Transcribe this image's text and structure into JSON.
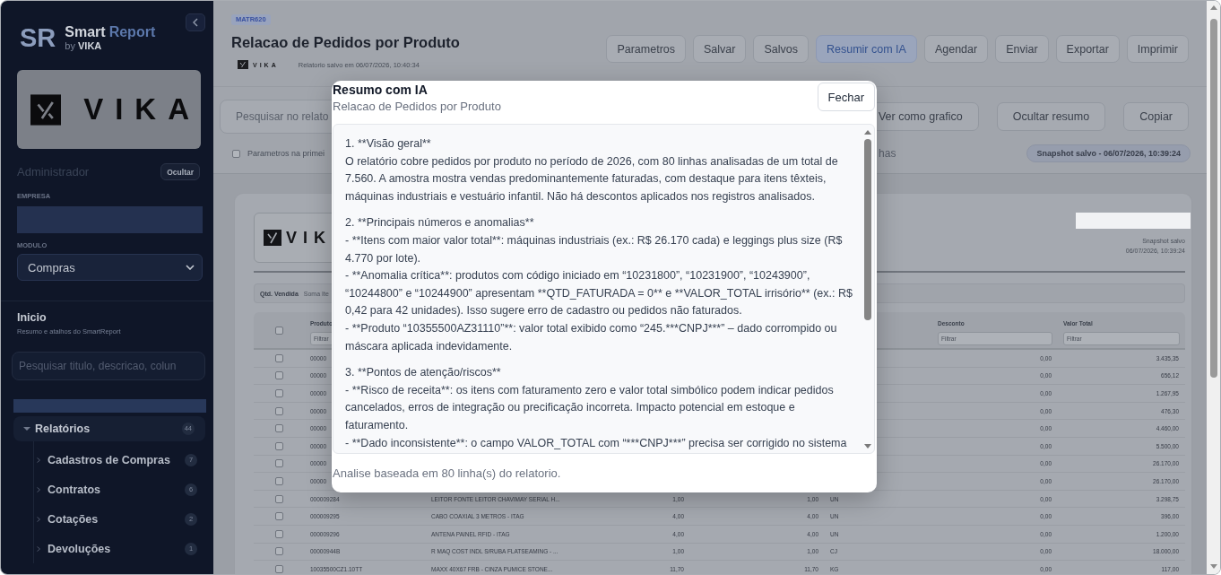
{
  "sidebar": {
    "brand": {
      "monogram": "SR",
      "name": "Smart",
      "accent": "Report",
      "byline": "by **VIKA**"
    },
    "logo_card": {
      "wordmark": "VIKA"
    },
    "user": {
      "role": "Administrador",
      "hide_button": "Ocultar"
    },
    "company": {
      "label": "EMPRESA"
    },
    "module": {
      "label": "MODULO",
      "value": "Compras"
    },
    "home": {
      "title": "Inicio",
      "subtitle": "Resumo e atalhos do SmartReport"
    },
    "search": {
      "placeholder": "Pesquisar titulo, descricao, colun"
    },
    "tree": [
      {
        "label": "Relatórios",
        "count": "44",
        "expanded": true,
        "children": [
          {
            "label": "Cadastros de Compras",
            "count": "7",
            "expanded": false
          },
          {
            "label": "Contratos",
            "count": "6",
            "expanded": false
          },
          {
            "label": "Cotações",
            "count": "2",
            "expanded": false
          },
          {
            "label": "Devoluções",
            "count": "1",
            "expanded": false
          }
        ]
      }
    ]
  },
  "header": {
    "code": "MATR620",
    "title": "Relacao de Pedidos por Produto",
    "logo_wordmark": "VIKA",
    "saved_note": "Relatorio salvo em 06/07/2026, 10:40:34",
    "actions": [
      {
        "label": "Parametros",
        "selected": false
      },
      {
        "label": "Salvar",
        "selected": false
      },
      {
        "label": "Salvos",
        "selected": false
      },
      {
        "label": "Resumir com IA",
        "selected": true
      },
      {
        "label": "Agendar",
        "selected": false
      },
      {
        "label": "Enviar",
        "selected": false
      },
      {
        "label": "Exportar",
        "selected": false
      },
      {
        "label": "Imprimir",
        "selected": false
      }
    ]
  },
  "toolbar": {
    "search": {
      "placeholder": "Pesquisar no relato"
    },
    "buttons": [
      "Ver como grafico",
      "Ocultar resumo",
      "Copiar"
    ],
    "option": {
      "label": "Parametros na primei",
      "checked": false
    },
    "option_tail": "has",
    "snapshot_badge": "Snapshot salvo - 06/07/2026, 10:39:24"
  },
  "report": {
    "logo_wordmark": "VIK",
    "snapshot_label": "Snapshot salvo",
    "snapshot_time": "06/07/2026, 10:39:24",
    "summary_label": "Qtd. Vendida",
    "summary_note": "Soma Ite",
    "table": {
      "select_all_checked": false,
      "columns": {
        "code": {
          "label": "Produto",
          "placeholder": "Filtrar"
        },
        "discount": {
          "label": "Desconto",
          "placeholder": "Filtrar"
        },
        "total": {
          "label": "Valor Total",
          "placeholder": "Filtrar"
        }
      },
      "rows": [
        {
          "checked": false,
          "code": "00000",
          "discount": "0,00",
          "total": "3.435,35"
        },
        {
          "checked": false,
          "code": "00000",
          "discount": "0,00",
          "total": "656,12"
        },
        {
          "checked": false,
          "code": "00000",
          "discount": "0,00",
          "total": "1.267,95"
        },
        {
          "checked": false,
          "code": "00000",
          "discount": "0,00",
          "total": "476,30"
        },
        {
          "checked": false,
          "code": "00000",
          "discount": "0,00",
          "total": "4.460,00"
        },
        {
          "checked": false,
          "code": "00000",
          "discount": "0,00",
          "total": "5.500,00"
        },
        {
          "checked": false,
          "code": "00000",
          "discount": "0,00",
          "total": "26.170,00"
        },
        {
          "checked": false,
          "code": "00000",
          "discount": "0,00",
          "total": "26.170,00"
        },
        {
          "checked": false,
          "code": "000009284",
          "description": "LEITOR FONTE LEITOR CHAVIMAY SERIAL H...",
          "qty": "1,00",
          "qty_billed": "1,00",
          "unit": "UN",
          "discount": "0,00",
          "total": "3.298,75"
        },
        {
          "checked": false,
          "code": "000009295",
          "description": "CABO COAXIAL 3 METROS - ITAG",
          "qty": "4,00",
          "qty_billed": "4,00",
          "unit": "UN",
          "discount": "0,00",
          "total": "396,00"
        },
        {
          "checked": false,
          "code": "000009296",
          "description": "ANTENA PAINEL RFID - ITAG",
          "qty": "4,00",
          "qty_billed": "4,00",
          "unit": "UN",
          "discount": "0,00",
          "total": "1.200,00"
        },
        {
          "checked": false,
          "code": "00000944B",
          "description": "R MAQ COST INDL S/RUBA FLATSEAMING - ...",
          "qty": "1,00",
          "qty_billed": "1,00",
          "unit": "CJ",
          "discount": "0,00",
          "total": "18.000,00"
        },
        {
          "checked": false,
          "code": "10035500CZ1.10TT",
          "description": "MAXX 40X67 FRB - CINZA PUMICE STONE...",
          "qty": "11,70",
          "qty_billed": "11,70",
          "unit": "KG",
          "discount": "0,00",
          "total": "117,00"
        }
      ]
    }
  },
  "dialog": {
    "title": "Resumo com IA",
    "subtitle": "Relacao de Pedidos por Produto",
    "close_button": "Fechar",
    "sections": [
      {
        "lines": [
          "1. **Visão geral**",
          "O relatório cobre pedidos por produto no período de 2026, com 80 linhas analisadas de um total de 7.560. A amostra mostra vendas predominantemente faturadas, com destaque para itens têxteis, máquinas industriais e vestuário infantil. Não há descontos aplicados nos registros analisados."
        ]
      },
      {
        "lines": [
          "2. **Principais números e anomalias**",
          "- **Itens com maior valor total**: máquinas industriais (ex.: R$ 26.170 cada) e leggings plus size (R$ 4.770 por lote).",
          "- **Anomalia crítica**: produtos com código iniciado em “10231800”, “10231900”, “10243900”, “10244800” e “10244900” apresentam **QTD_FATURADA = 0** e **VALOR_TOTAL irrisório** (ex.: R$ 0,42 para 42 unidades). Isso sugere erro de cadastro ou pedidos não faturados.",
          "- **Produto “10355500AZ31110”**: valor total exibido como “245.***CNPJ***” – dado corrompido ou máscara aplicada indevidamente."
        ]
      },
      {
        "lines": [
          "3. **Pontos de atenção/riscos**",
          "- **Risco de receita**: os itens com faturamento zero e valor total simbólico podem indicar pedidos cancelados, erros de integração ou precificação incorreta. Impacto potencial em estoque e faturamento.",
          "- **Dado inconsistente**: o campo VALOR_TOTAL com “***CNPJ***” precisa ser corrigido no sistema"
        ]
      }
    ],
    "footer": "Analise baseada em 80 linha(s) do relatorio."
  }
}
